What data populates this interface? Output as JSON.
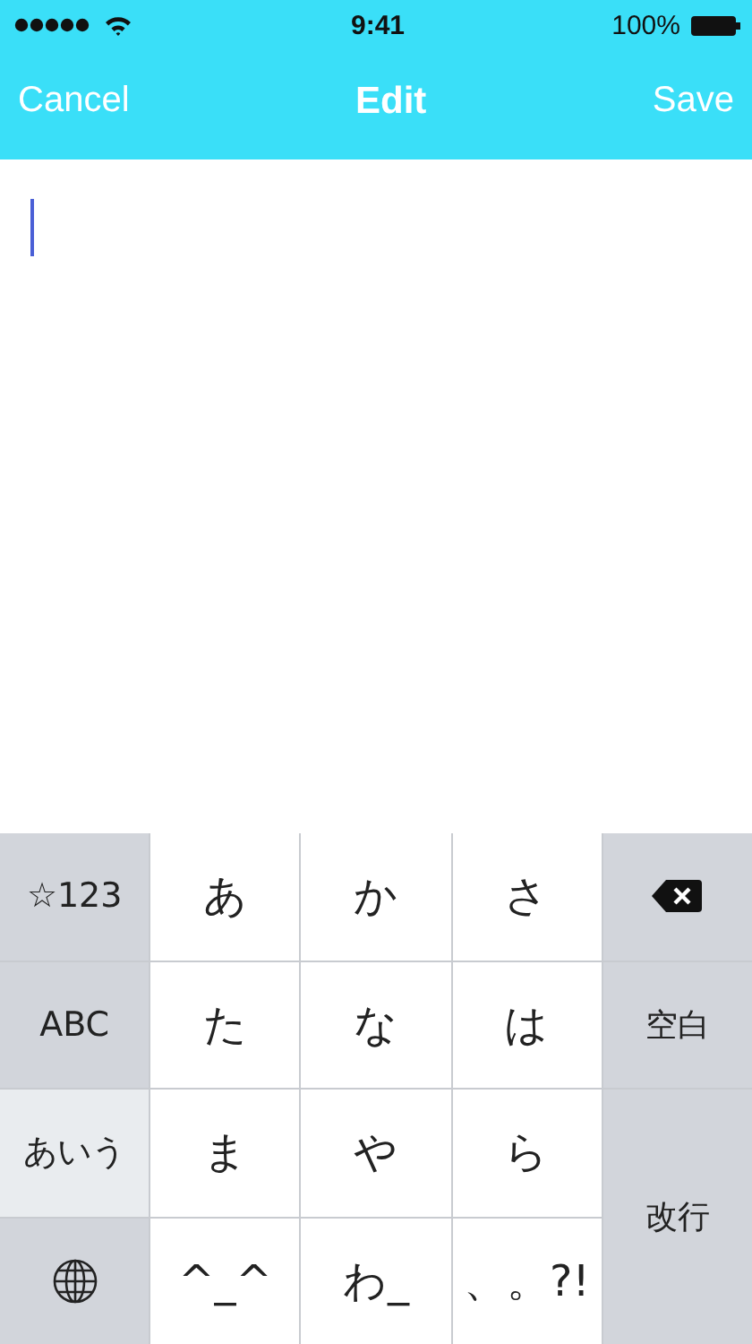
{
  "status_bar": {
    "time": "9:41",
    "battery": "100%"
  },
  "nav_bar": {
    "cancel": "Cancel",
    "title": "Edit",
    "save": "Save"
  },
  "editor": {
    "focused": true
  },
  "keyboard": {
    "left_keys": [
      {
        "kind": "text",
        "label": "☆123",
        "selected": false
      },
      {
        "kind": "text",
        "label": "ABC",
        "selected": false
      },
      {
        "kind": "text",
        "label": "あいう",
        "selected": true
      },
      {
        "kind": "globe",
        "selected": false
      }
    ],
    "kana_keys": [
      "あ",
      "か",
      "さ",
      "た",
      "な",
      "は",
      "ま",
      "や",
      "ら",
      "^_^",
      "わ_",
      "、。?!"
    ],
    "right_keys": [
      {
        "kind": "delete"
      },
      {
        "kind": "space",
        "label": "空白"
      },
      {
        "kind": "return",
        "label": "改行"
      }
    ]
  }
}
